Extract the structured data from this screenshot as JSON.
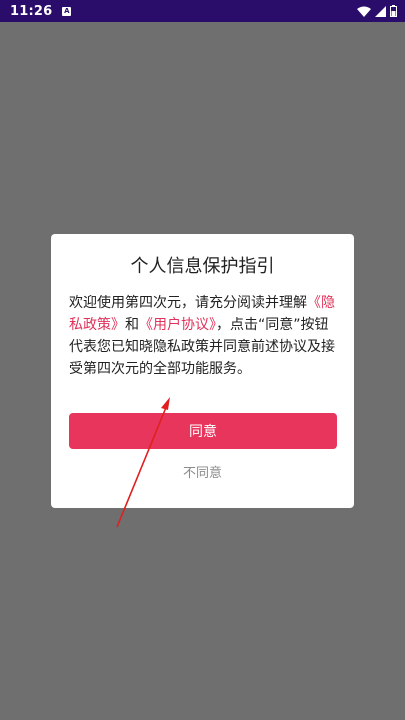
{
  "status_bar": {
    "time": "11:26",
    "notification_icon_letter": "A",
    "icons": [
      "wifi-icon",
      "signal-icon",
      "battery-icon"
    ]
  },
  "dialog": {
    "title": "个人信息保护指引",
    "body": {
      "text_1": "欢迎使用第四次元，请充分阅读并理解",
      "privacy_link": "《隐私政策》",
      "text_2": "和",
      "user_agreement_link": "《用户协议》",
      "text_3": "，点击“同意”按钮代表您已知晓隐私政策并同意前述协议及接受第四次元的全部功能服务。"
    },
    "agree_label": "同意",
    "disagree_label": "不同意"
  },
  "colors": {
    "status_bar": "#2a0d6b",
    "overlay": "#6f6f6f",
    "accent": "#e8355c",
    "link": "#e0325a",
    "annotation_arrow": "#e02020"
  }
}
